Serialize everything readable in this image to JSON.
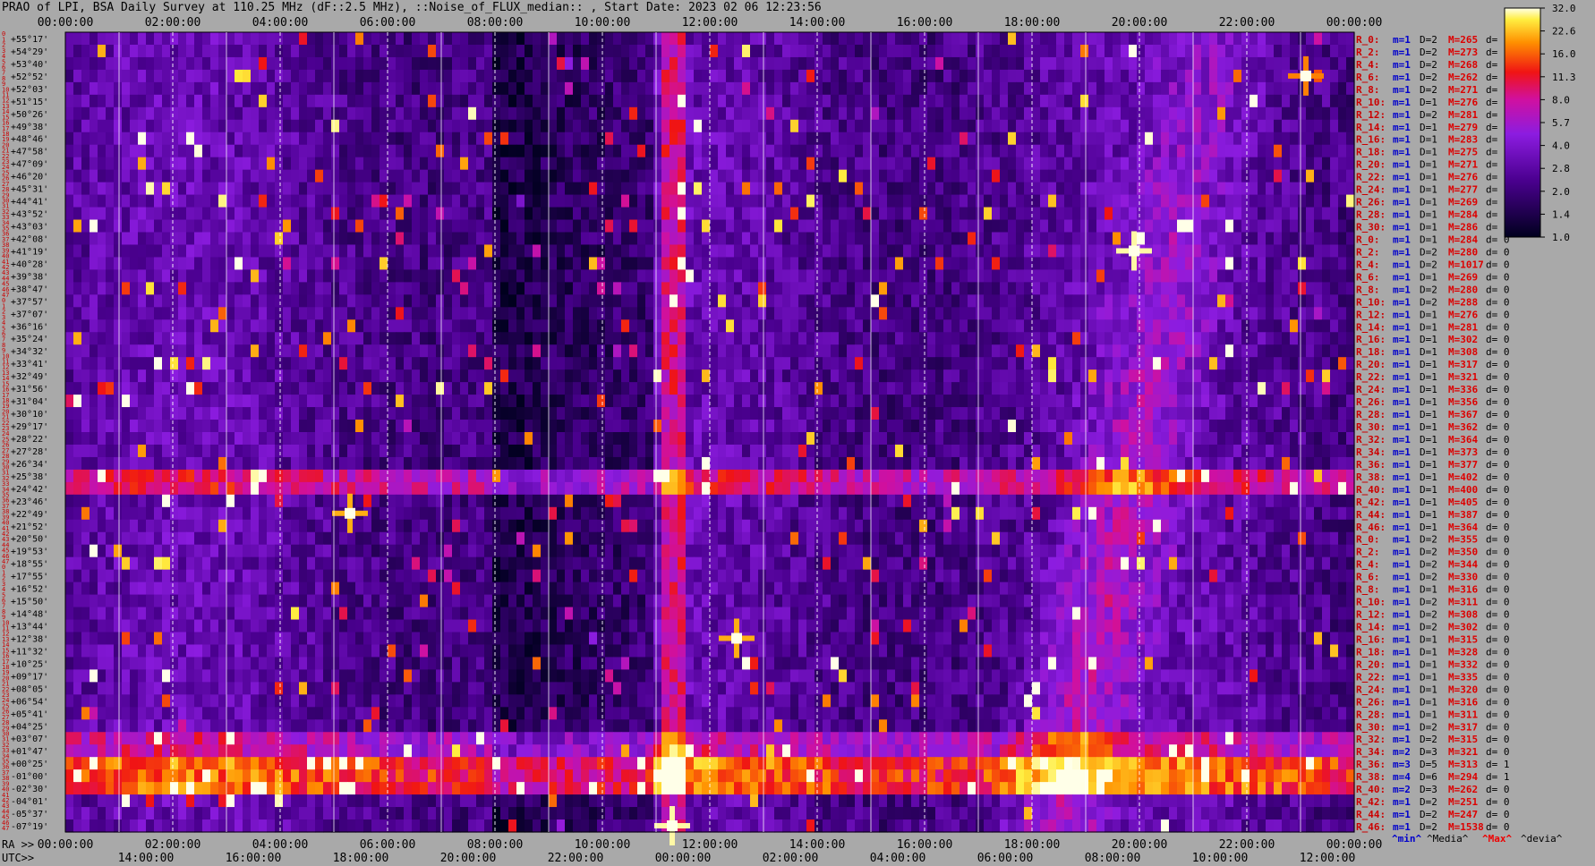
{
  "title": "PRAO of LPI, BSA Daily Survey at 110.25 MHz (dF::2.5 MHz), ::Noise_of_FLUX_median:: , Start Date: 2023 02 06 12:23:56",
  "chart_data": {
    "type": "heatmap",
    "title": "PRAO of LPI, BSA Daily Survey at 110.25 MHz (dF::2.5 MHz), ::Noise_of_FLUX_median:: , Start Date: 2023 02 06 12:23:56",
    "top_axis_ticks": [
      "00:00:00",
      "02:00:00",
      "04:00:00",
      "06:00:00",
      "08:00:00",
      "10:00:00",
      "12:00:00",
      "14:00:00",
      "16:00:00",
      "18:00:00",
      "20:00:00",
      "22:00:00",
      "00:00:00"
    ],
    "ra_axis_label": "RA >>",
    "ra_axis_ticks": [
      "00:00:00",
      "02:00:00",
      "04:00:00",
      "06:00:00",
      "08:00:00",
      "10:00:00",
      "12:00:00",
      "14:00:00",
      "16:00:00",
      "18:00:00",
      "20:00:00",
      "22:00:00",
      "00:00:00"
    ],
    "utc_axis_label": "UTC>>",
    "utc_axis_ticks": [
      "14:00:00",
      "16:00:00",
      "18:00:00",
      "20:00:00",
      "22:00:00",
      "00:00:00",
      "02:00:00",
      "04:00:00",
      "06:00:00",
      "08:00:00",
      "10:00:00",
      "12:00:00"
    ],
    "colorbar_ticks": [
      "32.0",
      "22.6",
      "16.0",
      "11.3",
      "8.0",
      "5.7",
      "4.0",
      "2.8",
      "2.0",
      "1.4",
      "1.0"
    ],
    "row_index": [
      0,
      1,
      2,
      3,
      4,
      5,
      6,
      7,
      8,
      9,
      10,
      11,
      12,
      13,
      14,
      15,
      16,
      17,
      18,
      19,
      20,
      21,
      22,
      23,
      24,
      25,
      26,
      27,
      28,
      29,
      30,
      31,
      32,
      33,
      34,
      35,
      36,
      37,
      38,
      39,
      40,
      41,
      42,
      43,
      44,
      45,
      46,
      47,
      0,
      1,
      2,
      3,
      4,
      5,
      6,
      7,
      8,
      9,
      10,
      11,
      12,
      13,
      14,
      15,
      16,
      17,
      18,
      19,
      20,
      21,
      22,
      23,
      24,
      25,
      26,
      27,
      28,
      29,
      30,
      31,
      32,
      33,
      34,
      35,
      36,
      37,
      38,
      39,
      40,
      41,
      42,
      43,
      44,
      45,
      46,
      47,
      0,
      1,
      2,
      3,
      4,
      5,
      6,
      7,
      8,
      9,
      10,
      11,
      12,
      13,
      14,
      15,
      16,
      17,
      18,
      19,
      20,
      21,
      22,
      23,
      24,
      25,
      26,
      27,
      28,
      29,
      30,
      31,
      32,
      33,
      34,
      35,
      36,
      37,
      38,
      39,
      40,
      41,
      42,
      43,
      44,
      45,
      46,
      47
    ],
    "declinations": [
      "+55°17'",
      "+54°29'",
      "+53°40'",
      "+52°52'",
      "+52°03'",
      "+51°15'",
      "+50°26'",
      "+49°38'",
      "+48°46'",
      "+47°58'",
      "+47°09'",
      "+46°20'",
      "+45°31'",
      "+44°41'",
      "+43°52'",
      "+43°03'",
      "+42°08'",
      "+41°19'",
      "+40°28'",
      "+39°38'",
      "+38°47'",
      "+37°57'",
      "+37°07'",
      "+36°16'",
      "+35°24'",
      "+34°32'",
      "+33°41'",
      "+32°49'",
      "+31°56'",
      "+31°04'",
      "+30°10'",
      "+29°17'",
      "+28°22'",
      "+27°28'",
      "+26°34'",
      "+25°38'",
      "+24°42'",
      "+23°46'",
      "+22°49'",
      "+21°52'",
      "+20°50'",
      "+19°53'",
      "+18°55'",
      "+17°55'",
      "+16°52'",
      "+15°50'",
      "+14°48'",
      "+13°44'",
      "+12°38'",
      "+11°32'",
      "+10°25'",
      "+09°17'",
      "+08°05'",
      "+06°54'",
      "+05°41'",
      "+04°25'",
      "+03°07'",
      "+01°47'",
      "+00°25'",
      "-01°00'",
      "-02°30'",
      "-04°01'",
      "-05°37'",
      "-07°19'"
    ],
    "bsa_rows": [
      {
        "r": "R_0:",
        "m": "m=1",
        "d": "D=2",
        "med": "M=265",
        "dev": "d= 0"
      },
      {
        "r": "R_2:",
        "m": "m=1",
        "d": "D=2",
        "med": "M=273",
        "dev": "d= 0"
      },
      {
        "r": "R_4:",
        "m": "m=1",
        "d": "D=2",
        "med": "M=268",
        "dev": "d= 0"
      },
      {
        "r": "R_6:",
        "m": "m=1",
        "d": "D=2",
        "med": "M=262",
        "dev": "d= 0"
      },
      {
        "r": "R_8:",
        "m": "m=1",
        "d": "D=2",
        "med": "M=271",
        "dev": "d= 0"
      },
      {
        "r": "R_10:",
        "m": "m=1",
        "d": "D=1",
        "med": "M=276",
        "dev": "d="
      },
      {
        "r": "R_12:",
        "m": "m=1",
        "d": "D=2",
        "med": "M=281",
        "dev": "d="
      },
      {
        "r": "R_14:",
        "m": "m=1",
        "d": "D=1",
        "med": "M=279",
        "dev": "d="
      },
      {
        "r": "R_16:",
        "m": "m=1",
        "d": "D=1",
        "med": "M=283",
        "dev": "d="
      },
      {
        "r": "R_18:",
        "m": "m=1",
        "d": "D=1",
        "med": "M=275",
        "dev": "d="
      },
      {
        "r": "R_20:",
        "m": "m=1",
        "d": "D=1",
        "med": "M=271",
        "dev": "d="
      },
      {
        "r": "R_22:",
        "m": "m=1",
        "d": "D=1",
        "med": "M=276",
        "dev": "d="
      },
      {
        "r": "R_24:",
        "m": "m=1",
        "d": "D=1",
        "med": "M=277",
        "dev": "d="
      },
      {
        "r": "R_26:",
        "m": "m=1",
        "d": "D=1",
        "med": "M=269",
        "dev": "d="
      },
      {
        "r": "R_28:",
        "m": "m=1",
        "d": "D=1",
        "med": "M=284",
        "dev": "d="
      },
      {
        "r": "R_30:",
        "m": "m=1",
        "d": "D=1",
        "med": "M=286",
        "dev": "d="
      },
      {
        "r": "R_0:",
        "m": "m=1",
        "d": "D=1",
        "med": "M=284",
        "dev": "d= 0"
      },
      {
        "r": "R_2:",
        "m": "m=1",
        "d": "D=2",
        "med": "M=280",
        "dev": "d= 0"
      },
      {
        "r": "R_4:",
        "m": "m=1",
        "d": "D=2",
        "med": "M=1017",
        "dev": "d= 0"
      },
      {
        "r": "R_6:",
        "m": "m=1",
        "d": "D=1",
        "med": "M=269",
        "dev": "d= 0"
      },
      {
        "r": "R_8:",
        "m": "m=1",
        "d": "D=2",
        "med": "M=280",
        "dev": "d= 0"
      },
      {
        "r": "R_10:",
        "m": "m=1",
        "d": "D=2",
        "med": "M=288",
        "dev": "d= 0"
      },
      {
        "r": "R_12:",
        "m": "m=1",
        "d": "D=1",
        "med": "M=276",
        "dev": "d= 0"
      },
      {
        "r": "R_14:",
        "m": "m=1",
        "d": "D=1",
        "med": "M=281",
        "dev": "d= 0"
      },
      {
        "r": "R_16:",
        "m": "m=1",
        "d": "D=1",
        "med": "M=302",
        "dev": "d= 0"
      },
      {
        "r": "R_18:",
        "m": "m=1",
        "d": "D=1",
        "med": "M=308",
        "dev": "d= 0"
      },
      {
        "r": "R_20:",
        "m": "m=1",
        "d": "D=1",
        "med": "M=317",
        "dev": "d= 0"
      },
      {
        "r": "R_22:",
        "m": "m=1",
        "d": "D=1",
        "med": "M=321",
        "dev": "d= 0"
      },
      {
        "r": "R_24:",
        "m": "m=1",
        "d": "D=1",
        "med": "M=336",
        "dev": "d= 0"
      },
      {
        "r": "R_26:",
        "m": "m=1",
        "d": "D=1",
        "med": "M=356",
        "dev": "d= 0"
      },
      {
        "r": "R_28:",
        "m": "m=1",
        "d": "D=1",
        "med": "M=367",
        "dev": "d= 0"
      },
      {
        "r": "R_30:",
        "m": "m=1",
        "d": "D=1",
        "med": "M=362",
        "dev": "d= 0"
      },
      {
        "r": "R_32:",
        "m": "m=1",
        "d": "D=1",
        "med": "M=364",
        "dev": "d= 0"
      },
      {
        "r": "R_34:",
        "m": "m=1",
        "d": "D=1",
        "med": "M=373",
        "dev": "d= 0"
      },
      {
        "r": "R_36:",
        "m": "m=1",
        "d": "D=1",
        "med": "M=377",
        "dev": "d= 0"
      },
      {
        "r": "R_38:",
        "m": "m=1",
        "d": "D=1",
        "med": "M=402",
        "dev": "d= 0"
      },
      {
        "r": "R_40:",
        "m": "m=1",
        "d": "D=1",
        "med": "M=400",
        "dev": "d= 0"
      },
      {
        "r": "R_42:",
        "m": "m=1",
        "d": "D=1",
        "med": "M=405",
        "dev": "d= 0"
      },
      {
        "r": "R_44:",
        "m": "m=1",
        "d": "D=1",
        "med": "M=387",
        "dev": "d= 0"
      },
      {
        "r": "R_46:",
        "m": "m=1",
        "d": "D=1",
        "med": "M=364",
        "dev": "d= 0"
      },
      {
        "r": "R_0:",
        "m": "m=1",
        "d": "D=2",
        "med": "M=355",
        "dev": "d= 0"
      },
      {
        "r": "R_2:",
        "m": "m=1",
        "d": "D=2",
        "med": "M=350",
        "dev": "d= 0"
      },
      {
        "r": "R_4:",
        "m": "m=1",
        "d": "D=2",
        "med": "M=344",
        "dev": "d= 0"
      },
      {
        "r": "R_6:",
        "m": "m=1",
        "d": "D=2",
        "med": "M=330",
        "dev": "d= 0"
      },
      {
        "r": "R_8:",
        "m": "m=1",
        "d": "D=1",
        "med": "M=316",
        "dev": "d= 0"
      },
      {
        "r": "R_10:",
        "m": "m=1",
        "d": "D=2",
        "med": "M=311",
        "dev": "d= 0"
      },
      {
        "r": "R_12:",
        "m": "m=1",
        "d": "D=2",
        "med": "M=308",
        "dev": "d= 0"
      },
      {
        "r": "R_14:",
        "m": "m=1",
        "d": "D=2",
        "med": "M=302",
        "dev": "d= 0"
      },
      {
        "r": "R_16:",
        "m": "m=1",
        "d": "D=1",
        "med": "M=315",
        "dev": "d= 0"
      },
      {
        "r": "R_18:",
        "m": "m=1",
        "d": "D=1",
        "med": "M=328",
        "dev": "d= 0"
      },
      {
        "r": "R_20:",
        "m": "m=1",
        "d": "D=1",
        "med": "M=332",
        "dev": "d= 0"
      },
      {
        "r": "R_22:",
        "m": "m=1",
        "d": "D=1",
        "med": "M=335",
        "dev": "d= 0"
      },
      {
        "r": "R_24:",
        "m": "m=1",
        "d": "D=1",
        "med": "M=320",
        "dev": "d= 0"
      },
      {
        "r": "R_26:",
        "m": "m=1",
        "d": "D=1",
        "med": "M=316",
        "dev": "d= 0"
      },
      {
        "r": "R_28:",
        "m": "m=1",
        "d": "D=1",
        "med": "M=311",
        "dev": "d= 0"
      },
      {
        "r": "R_30:",
        "m": "m=1",
        "d": "D=2",
        "med": "M=317",
        "dev": "d= 0"
      },
      {
        "r": "R_32:",
        "m": "m=1",
        "d": "D=2",
        "med": "M=315",
        "dev": "d= 0"
      },
      {
        "r": "R_34:",
        "m": "m=2",
        "d": "D=3",
        "med": "M=321",
        "dev": "d= 0"
      },
      {
        "r": "R_36:",
        "m": "m=3",
        "d": "D=5",
        "med": "M=313",
        "dev": "d= 1"
      },
      {
        "r": "R_38:",
        "m": "m=4",
        "d": "D=6",
        "med": "M=294",
        "dev": "d= 1"
      },
      {
        "r": "R_40:",
        "m": "m=2",
        "d": "D=3",
        "med": "M=262",
        "dev": "d= 0"
      },
      {
        "r": "R_42:",
        "m": "m=1",
        "d": "D=2",
        "med": "M=251",
        "dev": "d= 0"
      },
      {
        "r": "R_44:",
        "m": "m=1",
        "d": "D=2",
        "med": "M=247",
        "dev": "d= 0"
      },
      {
        "r": "R_46:",
        "m": "m=1",
        "d": "D=2",
        "med": "M=1538",
        "dev": "d= 0"
      }
    ],
    "legend": {
      "min": "^min^",
      "median": "^Media^",
      "max": "^Max^",
      "dev": "^devia^"
    },
    "colors": {
      "background": "#a9a9a9",
      "row_index": "#cc0000",
      "declination": "#000000",
      "median": "#dd0000",
      "min": "#0000cc",
      "max": "#ee0000"
    },
    "features": [
      {
        "kind": "horizontal_band",
        "row_from": 58,
        "row_to": 60,
        "ra_from": 0,
        "ra_to": 24,
        "strength": 0.82
      },
      {
        "kind": "horizontal_band",
        "row_from": 35,
        "row_to": 36,
        "ra_from": 0,
        "ra_to": 24,
        "strength": 0.55
      },
      {
        "kind": "horizontal_band",
        "row_from": 56,
        "row_to": 57,
        "ra_from": 0,
        "ra_to": 24,
        "strength": 0.45
      },
      {
        "kind": "vertical_band",
        "ra_from": 11.1,
        "ra_to": 11.6,
        "row_from": 0,
        "row_to": 63,
        "strength": 0.55
      },
      {
        "kind": "vertical_band",
        "ra_from": 8.0,
        "ra_to": 11.0,
        "row_from": 0,
        "row_to": 63,
        "strength": -0.3
      },
      {
        "kind": "galactic_plane",
        "ra_from": 18.4,
        "ra_to": 21.5,
        "row_from": 0,
        "row_to": 63,
        "strength": 0.6
      },
      {
        "kind": "point_source",
        "ra": 19.9,
        "row": 17,
        "strength": 1.0
      },
      {
        "kind": "point_source",
        "ra": 11.3,
        "row": 63,
        "strength": 1.0
      },
      {
        "kind": "point_source",
        "ra": 12.5,
        "row": 48,
        "strength": 0.9
      },
      {
        "kind": "point_source",
        "ra": 5.3,
        "row": 38,
        "strength": 0.9
      },
      {
        "kind": "point_source",
        "ra": 23.1,
        "row": 3,
        "strength": 0.85
      }
    ]
  }
}
